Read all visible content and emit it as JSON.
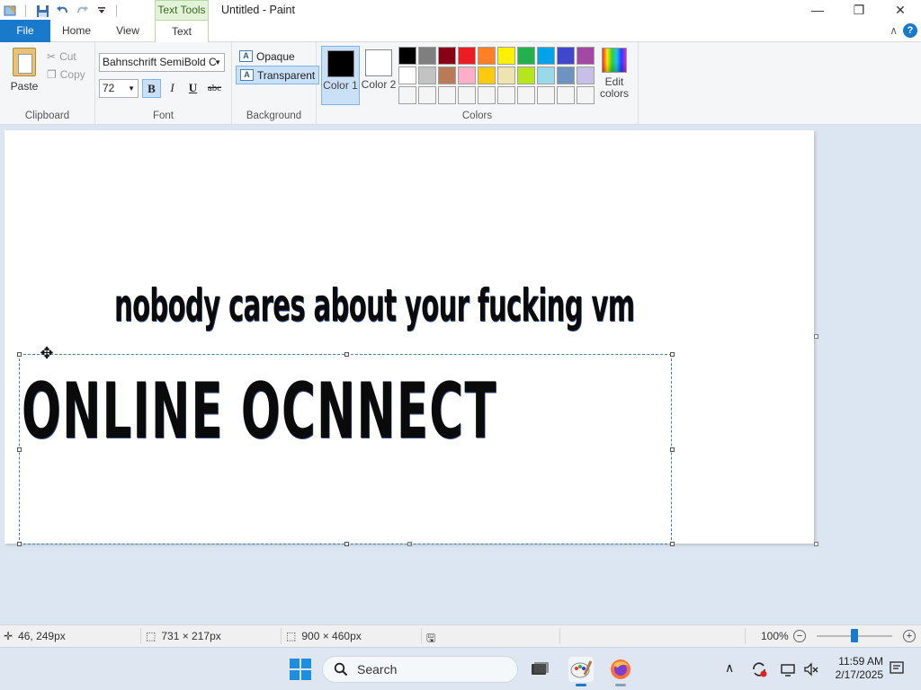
{
  "window": {
    "title": "Untitled - Paint",
    "context_tab": "Text Tools"
  },
  "tabs": [
    "File",
    "Home",
    "View",
    "Text"
  ],
  "clipboard": {
    "paste": "Paste",
    "cut": "Cut",
    "copy": "Copy",
    "label": "Clipboard"
  },
  "font": {
    "family": "Bahnschrift SemiBold C",
    "size": "72",
    "bold": "B",
    "italic": "I",
    "underline": "U",
    "strikethrough": "abc",
    "label": "Font"
  },
  "background": {
    "opaque": "Opaque",
    "transparent": "Transparent",
    "label": "Background"
  },
  "colors": {
    "color1_label": "Color 1",
    "color2_label": "Color 2",
    "color1": "#000000",
    "color2": "#ffffff",
    "edit_label": "Edit colors",
    "label": "Colors",
    "palette": [
      "#000000",
      "#7f7f7f",
      "#880015",
      "#ed1c24",
      "#ff7f27",
      "#fff200",
      "#22b14c",
      "#00a2e8",
      "#3f48cc",
      "#a349a4",
      "#ffffff",
      "#c3c3c3",
      "#b97a57",
      "#ffaec9",
      "#ffc90e",
      "#efe4b0",
      "#b5e61d",
      "#99d9ea",
      "#7092be",
      "#c8bfe7",
      "#f5f5f5",
      "#f5f5f5",
      "#f5f5f5",
      "#f5f5f5",
      "#f5f5f5",
      "#f5f5f5",
      "#f5f5f5",
      "#f5f5f5",
      "#f5f5f5",
      "#f5f5f5"
    ]
  },
  "canvas": {
    "text_line_1": "nobody cares about your fucking vm",
    "text_line_2": "ONLINE OCNNECT"
  },
  "status": {
    "cursor_pos": "46, 249px",
    "selection_size": "731 × 217px",
    "image_size": "900 × 460px",
    "zoom": "100%"
  },
  "taskbar": {
    "search_placeholder": "Search",
    "time": "11:59 AM",
    "date": "2/17/2025"
  }
}
